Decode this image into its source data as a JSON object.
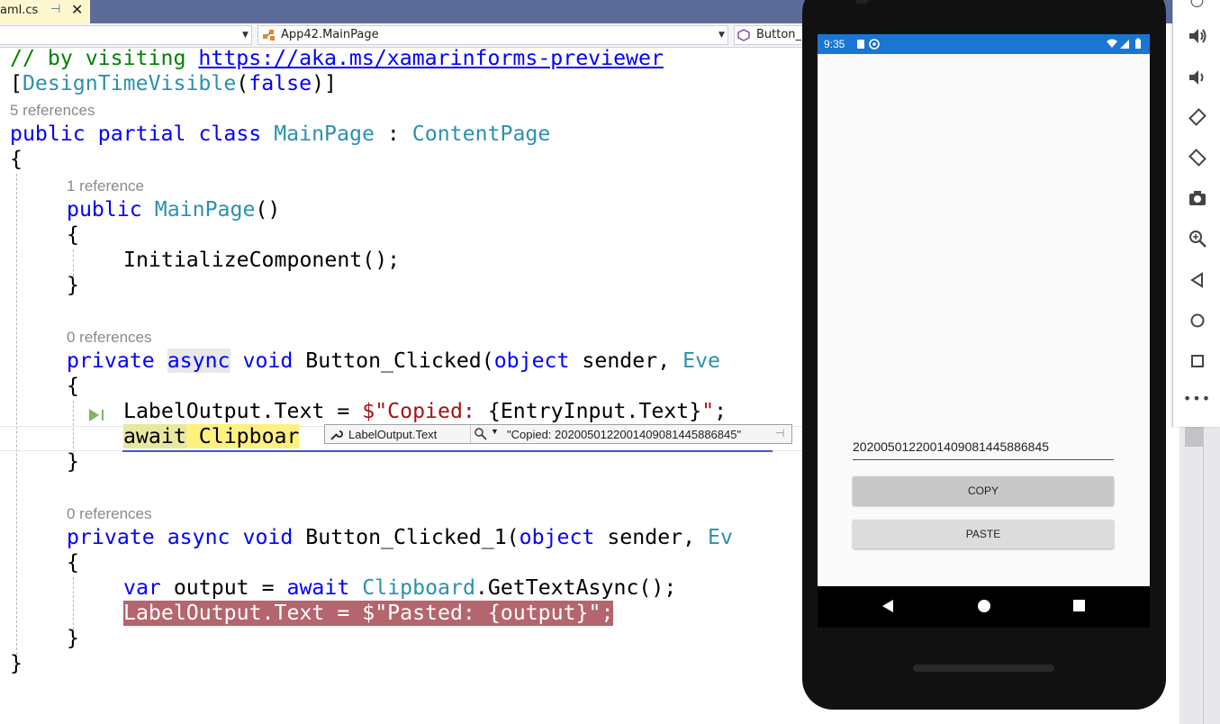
{
  "tab": {
    "label": "aml.cs",
    "pin_glyph": "⊣",
    "close_glyph": "✕"
  },
  "navbar": {
    "project_combo": "",
    "class_combo": "App42.MainPage",
    "member_combo": "Button_"
  },
  "code": {
    "line_comment_prefix": "// by visiting ",
    "line_comment_link": "https://aka.ms/xamarinforms-previewer",
    "line_attr_open": "[",
    "line_attr_name": "DesignTimeVisible",
    "line_attr_paren": "(",
    "line_attr_value": "false",
    "line_attr_close": ")]",
    "lens_class": "5 references",
    "class_public": "public",
    "class_partial": "partial",
    "class_kw": "class",
    "class_name": "MainPage",
    "class_colon": " : ",
    "class_base": "ContentPage",
    "brace_open_1": "{",
    "lens_ctor": "1 reference",
    "ctor_public": "public",
    "ctor_name": "MainPage",
    "ctor_parens": "()",
    "brace_open_2": "{",
    "init_call": "InitializeComponent();",
    "brace_close_2": "}",
    "lens_m1": "0 references",
    "m1_private": "private",
    "m1_async": "async",
    "m1_void": "void",
    "m1_name": "Button_Clicked(",
    "m1_object": "object",
    "m1_sender": " sender, ",
    "m1_event": "Eve",
    "brace_open_3": "{",
    "m1_line1_a": "LabelOutput.Text = ",
    "m1_line1_str": "$\"Copied: ",
    "m1_line1_interp": "{EntryInput.Text}",
    "m1_line1_end_str": "\"",
    "m1_line1_semi": ";",
    "m1_line2_await": "await",
    "m1_line2_rest": " Clipboar",
    "brace_close_3": "}",
    "lens_m2": "0 references",
    "m2_private": "private",
    "m2_async": "async",
    "m2_void": "void",
    "m2_name": "Button_Clicked_1(",
    "m2_object": "object",
    "m2_sender": " sender, ",
    "m2_event": "Ev",
    "brace_open_4": "{",
    "m2_line1_var": "var",
    "m2_line1_mid": " output = ",
    "m2_line1_await": "await",
    "m2_line1_cls": "Clipboard",
    "m2_line1_call": ".GetTextAsync();",
    "m2_line2": "LabelOutput.Text = $\"Pasted: {output}\";",
    "brace_close_4": "}",
    "brace_close_1": "}"
  },
  "datatip": {
    "name": "LabelOutput.Text",
    "value": "\"Copied: 2020050122001409081445886845\""
  },
  "emulator": {
    "time": "9:35",
    "entry_text": "2020050122001409081445886845",
    "copy_label": "COPY",
    "paste_label": "PASTE"
  },
  "colors": {
    "keyword": "#0000ff",
    "type": "#2b91af",
    "string": "#a31515",
    "comment": "#008000",
    "breakpoint": "#b5656d",
    "tab_active": "#fff8cf",
    "statusbar": "#1976d2"
  },
  "toolbar_icons": [
    "power-icon",
    "volume-up-icon",
    "volume-down-icon",
    "rotate-left-icon",
    "rotate-right-icon",
    "camera-icon",
    "zoom-icon",
    "back-icon",
    "home-icon",
    "overview-icon",
    "more-icon"
  ]
}
